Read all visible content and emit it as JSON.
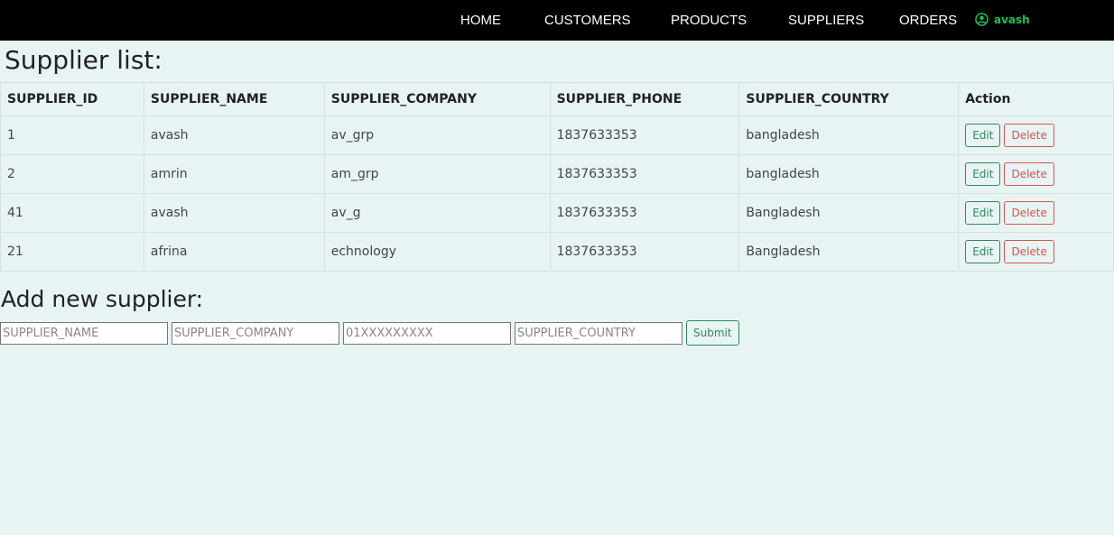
{
  "nav": {
    "items": [
      "HOME",
      "CUSTOMERS",
      "PRODUCTS",
      "SUPPLIERS",
      "ORDERS"
    ],
    "user": "avash",
    "user_icon": "user-circle-icon"
  },
  "list_title": "Supplier list:",
  "table": {
    "columns": [
      "SUPPLIER_ID",
      "SUPPLIER_NAME",
      "SUPPLIER_COMPANY",
      "SUPPLIER_PHONE",
      "SUPPLIER_COUNTRY",
      "Action"
    ],
    "rows": [
      [
        "1",
        "avash",
        "av_grp",
        "1837633353",
        "bangladesh"
      ],
      [
        "2",
        "amrin",
        "am_grp",
        "1837633353",
        "bangladesh"
      ],
      [
        "41",
        "avash",
        "av_g",
        "1837633353",
        "Bangladesh"
      ],
      [
        "21",
        "afrina",
        "echnology",
        "1837633353",
        "Bangladesh"
      ]
    ],
    "edit_label": "Edit",
    "delete_label": "Delete"
  },
  "add_title": "Add new supplier:",
  "form": {
    "name_placeholder": "SUPPLIER_NAME",
    "company_placeholder": "SUPPLIER_COMPANY",
    "phone_placeholder": "01XXXXXXXXX",
    "country_placeholder": "SUPPLIER_COUNTRY",
    "submit_label": "Submit"
  },
  "colors": {
    "navbar": "#000000",
    "user_accent": "#19c552",
    "background": "#e8f4f3",
    "edit": "#2f8a5d",
    "delete": "#d9534f"
  }
}
